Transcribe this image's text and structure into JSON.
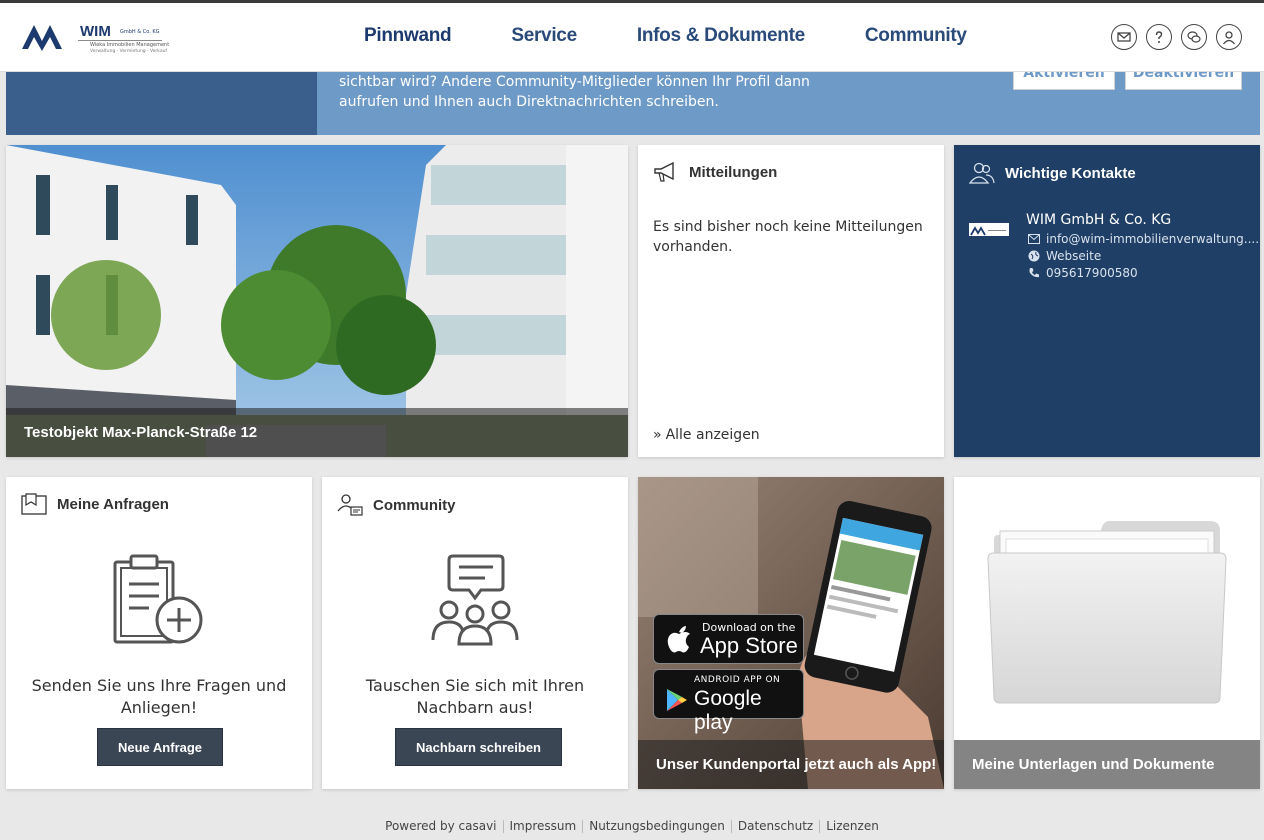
{
  "brand": {
    "name": "WIM",
    "suffix": "GmbH & Co. KG",
    "tagline1": "Wieka Immobilien Management",
    "tagline2": "Verwaltung · Vermietung · Verkauf"
  },
  "nav": {
    "items": [
      "Pinnwand",
      "Service",
      "Infos & Dokumente",
      "Community"
    ]
  },
  "banner": {
    "text": "sichtbar wird? Andere Community-Mitglieder können Ihr Profil dann aufrufen und Ihnen auch Direktnachrichten schreiben.",
    "activate": "Aktivieren",
    "deactivate": "Deaktivieren"
  },
  "property": {
    "caption": "Testobjekt Max-Planck-Straße 12"
  },
  "messages": {
    "title": "Mitteilungen",
    "empty": "Es sind bisher noch keine Mitteilungen vorhanden.",
    "show_all": "Alle anzeigen"
  },
  "contacts": {
    "title": "Wichtige Kontakte",
    "company": "WIM GmbH & Co. KG",
    "email": "info@wim-immobilienverwaltung....",
    "website": "Webseite",
    "phone": "095617900580"
  },
  "requests": {
    "title": "Meine Anfragen",
    "text": "Senden Sie uns Ihre Fragen und Anliegen!",
    "button": "Neue Anfrage"
  },
  "community": {
    "title": "Community",
    "text": "Tauschen Sie sich mit Ihren Nachbarn aus!",
    "button": "Nachbarn schreiben"
  },
  "app": {
    "caption": "Unser Kundenportal jetzt auch als App!",
    "appstore_small": "Download on the",
    "appstore_big": "App Store",
    "play_small": "ANDROID APP ON",
    "play_big": "Google play"
  },
  "documents": {
    "caption": "Meine Unterlagen und Dokumente"
  },
  "footer": {
    "links": [
      "Powered by casavi",
      "Impressum",
      "Nutzungsbedingungen",
      "Datenschutz",
      "Lizenzen"
    ]
  },
  "colors": {
    "nav": "#2a4a7a",
    "contacts_bg": "#1f3f66",
    "banner": "#6e9ac7",
    "button": "#3a4654"
  }
}
